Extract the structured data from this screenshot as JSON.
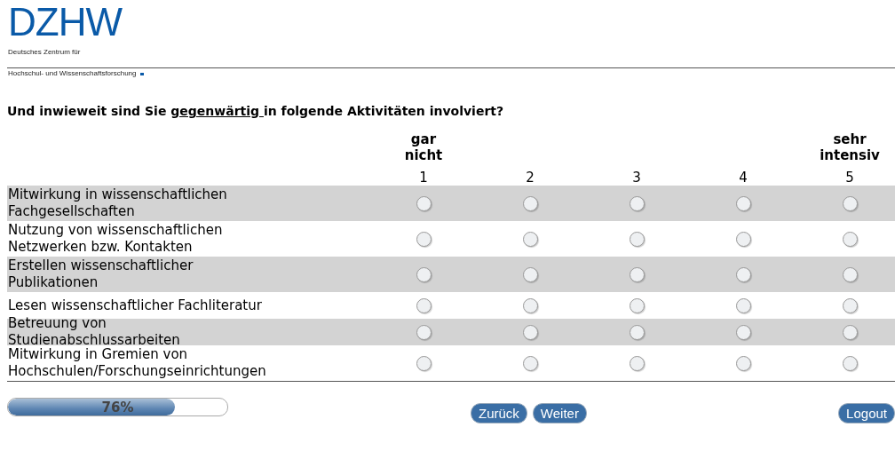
{
  "logo": {
    "wordmark": "DZHW",
    "subtitle_lines": [
      "Deutsches Zentrum für",
      "Hochschul- und Wissenschaftsforschung"
    ]
  },
  "question": {
    "parts": [
      {
        "text": "Und inwieweit sind Sie ",
        "underline": false
      },
      {
        "text": "gegenwärtig ",
        "underline": true
      },
      {
        "text": "in folgende Aktivitäten involviert?",
        "underline": false
      }
    ]
  },
  "scale": [
    {
      "anchor": "gar nicht",
      "number": "1"
    },
    {
      "number": "2"
    },
    {
      "number": "3"
    },
    {
      "number": "4"
    },
    {
      "anchor": "sehr intensiv",
      "number": "5"
    }
  ],
  "rows": [
    {
      "label": "Mitwirkung in wissenschaftlichen Fachgesellschaften",
      "options": [
        {
          "selected": false
        },
        {
          "selected": false
        },
        {
          "selected": false
        },
        {
          "selected": false
        },
        {
          "selected": false
        }
      ]
    },
    {
      "label": "Nutzung von wissenschaftlichen Netzwerken bzw. Kontakten",
      "options": [
        {
          "selected": false
        },
        {
          "selected": false
        },
        {
          "selected": false
        },
        {
          "selected": false
        },
        {
          "selected": false
        }
      ]
    },
    {
      "label": "Erstellen wissenschaftlicher Publikationen",
      "options": [
        {
          "selected": false
        },
        {
          "selected": false
        },
        {
          "selected": false
        },
        {
          "selected": false
        },
        {
          "selected": false
        }
      ]
    },
    {
      "label": "Lesen wissenschaftlicher Fachliteratur",
      "options": [
        {
          "selected": false
        },
        {
          "selected": false
        },
        {
          "selected": false
        },
        {
          "selected": false
        },
        {
          "selected": false
        }
      ]
    },
    {
      "label": "Betreuung von Studienabschlussarbeiten",
      "options": [
        {
          "selected": false
        },
        {
          "selected": false
        },
        {
          "selected": false
        },
        {
          "selected": false
        },
        {
          "selected": false
        }
      ]
    },
    {
      "label": "Mitwirkung in Gremien von Hochschulen/Forschungseinrichtungen",
      "options": [
        {
          "selected": false
        },
        {
          "selected": false
        },
        {
          "selected": false
        },
        {
          "selected": false
        },
        {
          "selected": false
        }
      ]
    }
  ],
  "progress": {
    "level": 0.76,
    "text": "76%"
  },
  "nav_buttons": [
    "Zurück",
    "Weiter"
  ],
  "logout": "Logout"
}
